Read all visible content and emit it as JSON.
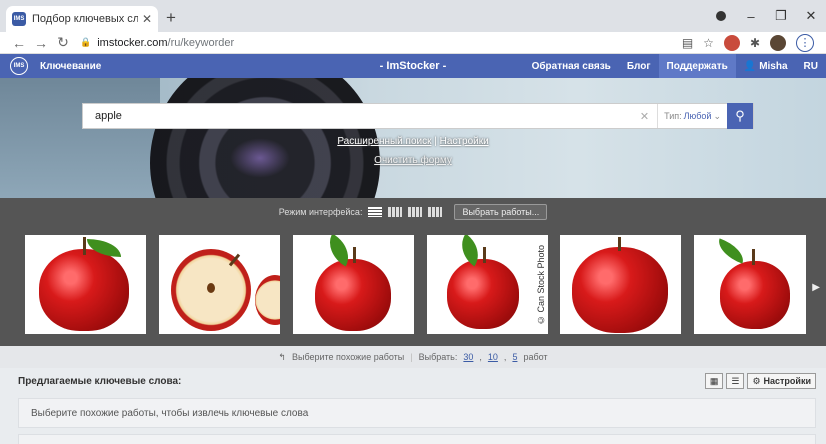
{
  "browser": {
    "tab_title": "Подбор ключевых слов для м…",
    "url_host": "imstocker.com",
    "url_path": "/ru/keyworder"
  },
  "header": {
    "logo_text": "IMS",
    "left_link": "Ключевание",
    "title": "- ImStocker -",
    "links": [
      "Обратная связь",
      "Блог",
      "Поддержать",
      "Misha",
      "RU"
    ]
  },
  "search": {
    "value": "apple",
    "type_label": "Тип:",
    "type_value": "Любой",
    "advanced": "Расширенный поиск",
    "settings": "Настройки",
    "clear": "Очистить форму"
  },
  "mode": {
    "label": "Режим интерфейса:",
    "select_button": "Выбрать работы..."
  },
  "gallery": {
    "watermark": "© Can Stock Photo"
  },
  "selection": {
    "hint": "Выберите похожие работы",
    "select_label": "Выбрать:",
    "opt1": "30",
    "opt2": "10",
    "opt3": "5",
    "suffix": "работ"
  },
  "keywords": {
    "title": "Предлагаемые ключевые слова:",
    "settings_button": "Настройки",
    "placeholder": "Выберите похожие работы, чтобы извлечь ключевые слова"
  }
}
